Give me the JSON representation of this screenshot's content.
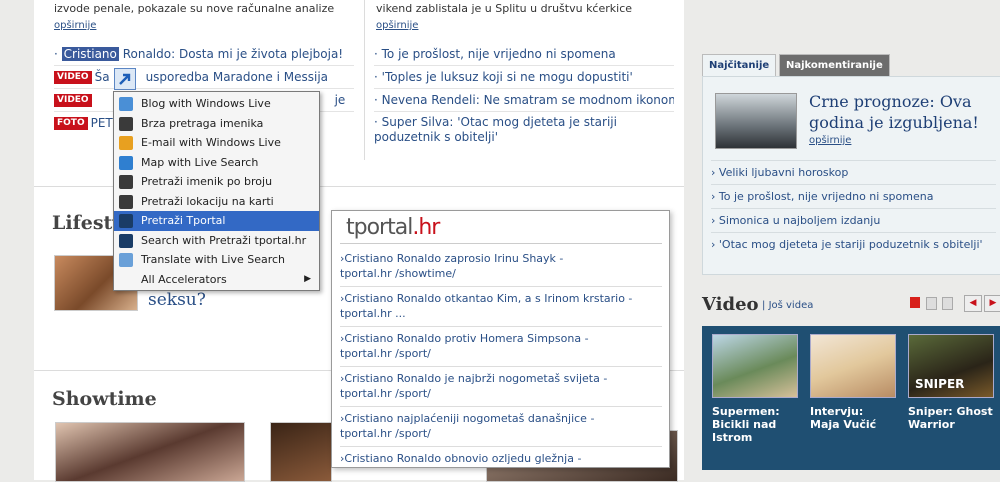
{
  "top": {
    "left_snippet": "izvode penale, pokazale su nove računalne analize",
    "left_more": "opširnije",
    "right_snippet": "vikend zablistala je u Splitu u društvu kćerkice",
    "right_more": "opširnije"
  },
  "left_links": [
    {
      "selected": "Cristiano",
      "text": " Ronaldo: Dosta mi je života plejboja!"
    },
    {
      "badge": "VIDEO",
      "text": "Ša",
      "text2": "usporedba Maradone i Messija"
    },
    {
      "badge": "VIDEO",
      "text": "",
      "text2": "je"
    },
    {
      "badge": "FOTO",
      "text": "PET"
    }
  ],
  "right_links": [
    "To je prošlost, nije vrijedno ni spomena",
    "'Toples je luksuz koji si ne mogu dopustiti'",
    "Nevena Rendeli: Ne smatram se modnom ikonom",
    "Super Silva: 'Otac mog djeteta je stariji poduzetnik s obitelji'"
  ],
  "lifestyle": {
    "title": "Lifesty",
    "headline_tail": "seksu?"
  },
  "showtime": {
    "title": "Showtime"
  },
  "context_menu": {
    "items": [
      {
        "label": "Blog with Windows Live",
        "icon": "blog-icon",
        "color": "#4a8fd6"
      },
      {
        "label": "Brza pretraga imenika",
        "icon": "directory-icon",
        "color": "#3a3a3a"
      },
      {
        "label": "E-mail with Windows Live",
        "icon": "email-icon",
        "color": "#e8a020"
      },
      {
        "label": "Map with Live Search",
        "icon": "map-icon",
        "color": "#2f7fd0"
      },
      {
        "label": "Pretraži imenik po broju",
        "icon": "phonebook-icon",
        "color": "#3a3a3a"
      },
      {
        "label": "Pretraži lokaciju na karti",
        "icon": "location-icon",
        "color": "#3a3a3a"
      },
      {
        "label": "Pretraži Tportal",
        "icon": "tportal-icon",
        "color": "#1a3c66",
        "active": true
      },
      {
        "label": "Search with Pretraži tportal.hr",
        "icon": "tportal-search-icon",
        "color": "#1a3c66"
      },
      {
        "label": "Translate with Live Search",
        "icon": "translate-icon",
        "color": "#6aa0d8"
      },
      {
        "label": "All Accelerators",
        "icon": "",
        "color": "",
        "submenu": true
      }
    ]
  },
  "preview": {
    "logo_a": "tportal",
    "logo_b": ".hr",
    "results": [
      {
        "title": "Cristiano Ronaldo zaprosio Irinu Shayk -",
        "url": "tportal.hr /showtime/"
      },
      {
        "title": "Cristiano Ronaldo otkantao Kim, a s Irinom krstario -",
        "url": "tportal.hr ..."
      },
      {
        "title": "Cristiano Ronaldo protiv Homera Simpsona -",
        "url": "tportal.hr /sport/"
      },
      {
        "title": "Cristiano Ronaldo je najbrži nogometaš svijeta -",
        "url": "tportal.hr /sport/"
      },
      {
        "title": "Cristiano najplaćeniji nogometaš današnjice -",
        "url": "tportal.hr /sport/"
      },
      {
        "title": "Cristiano Ronaldo obnovio ozljedu gležnja -",
        "url": ""
      }
    ]
  },
  "sidebar": {
    "tab_on": "Najčitanije",
    "tab_off": "Najkomentiranije",
    "feature_title": "Crne prognoze: Ova godina je izgubljena!",
    "feature_more": "opširnije",
    "links": [
      "Veliki ljubavni horoskop",
      "To je prošlost, nije vrijedno ni spomena",
      "Simonica u najboljem izdanju",
      "'Otac mog djeteta je stariji poduzetnik s obitelji'"
    ],
    "video_title": "Video",
    "video_more": "Još videa",
    "videos": [
      {
        "caption": "Supermen: Bicikli nad Istrom"
      },
      {
        "caption": "Intervju: Maja Vučić"
      },
      {
        "caption": "Sniper: Ghost Warrior",
        "thumb_text": "SNIPER"
      }
    ]
  }
}
